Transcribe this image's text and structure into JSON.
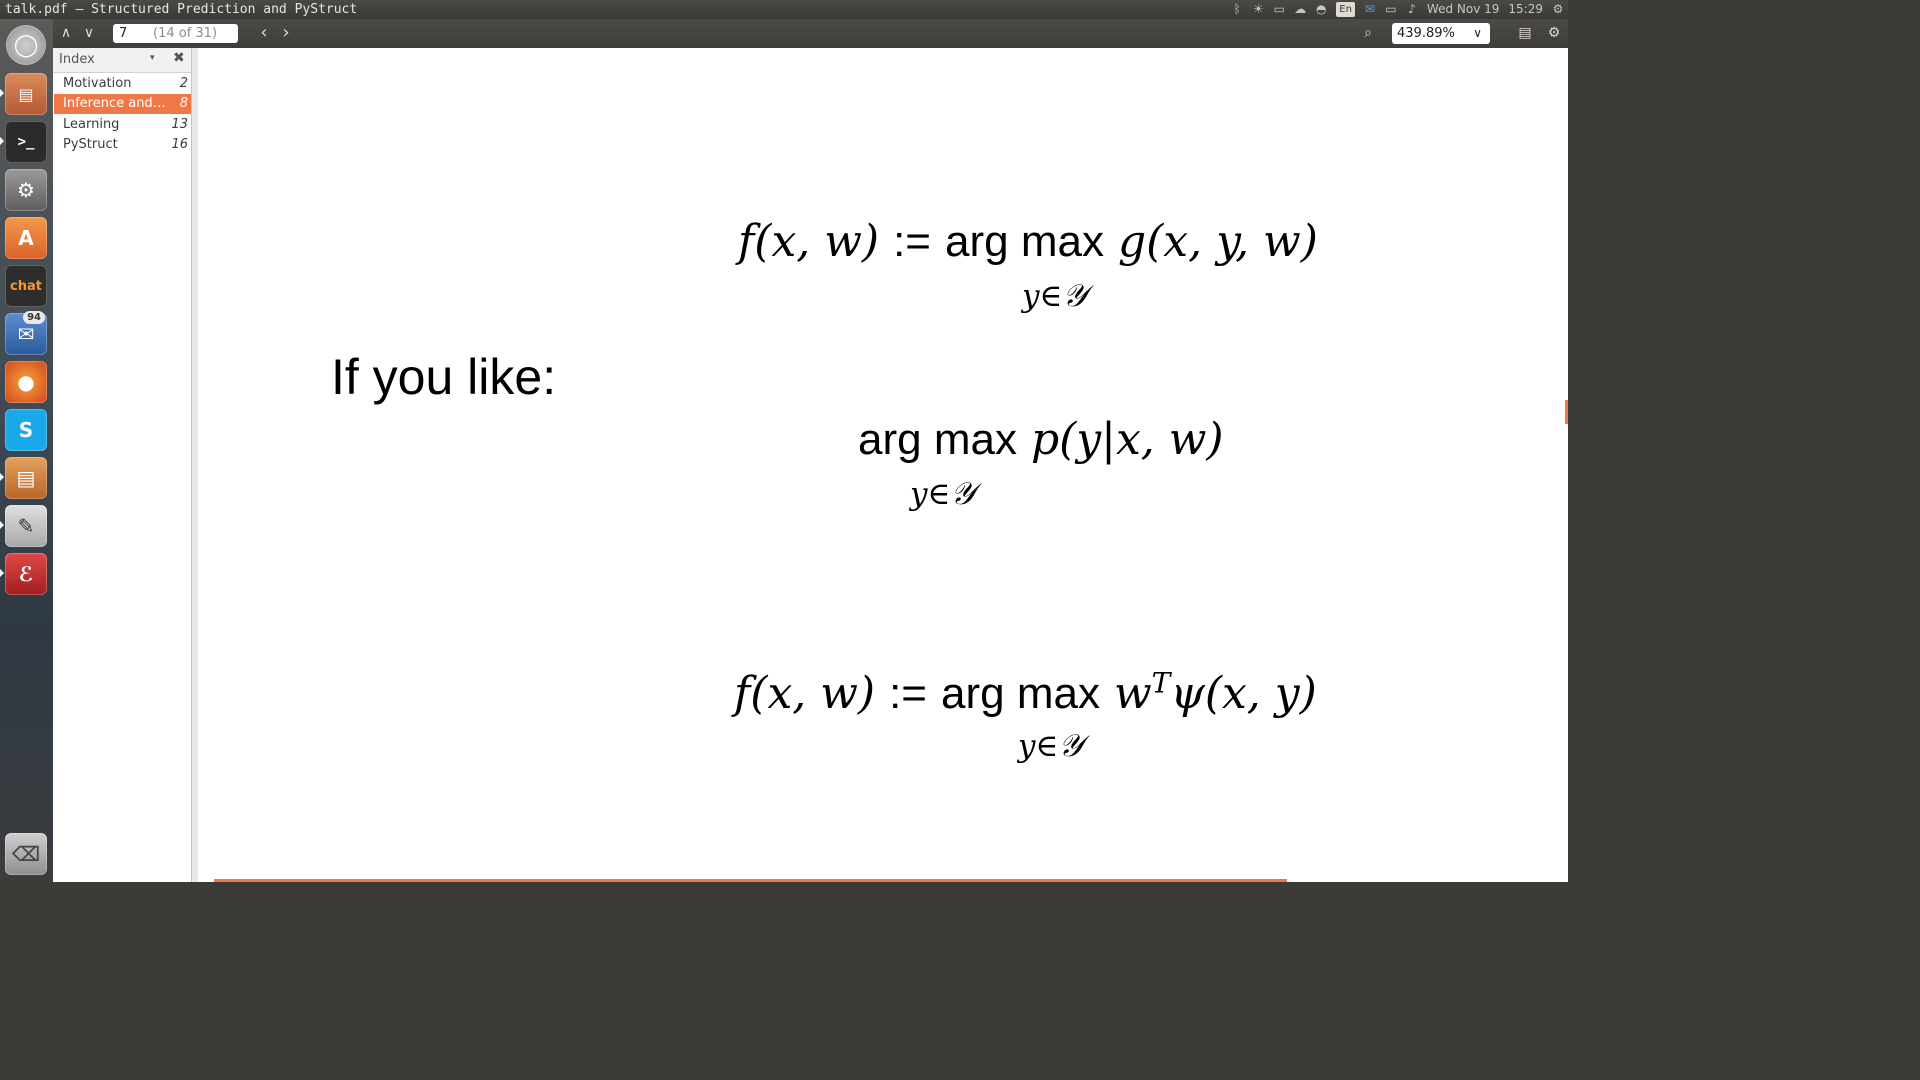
{
  "window": {
    "title": "talk.pdf — Structured Prediction and PyStruct"
  },
  "indicators": {
    "bluetooth": "ᛒ",
    "brightness": "☀",
    "display": "▭",
    "cloud": "☁",
    "wifi": "◓",
    "lang": "En",
    "mail": "✉",
    "battery": "▭",
    "volume": "♪",
    "date": "Wed Nov 19",
    "time": "15:29",
    "gear": "⚙"
  },
  "toolbar": {
    "prev_label": "∧",
    "next_label": "∨",
    "page_current": "7",
    "page_total": "(14 of 31)",
    "back_label": "‹",
    "forward_label": "›",
    "search_label": "⌕",
    "zoom": "439.89%",
    "zoom_chevron": "∨",
    "doc_label": "▤",
    "settings_label": "⚙"
  },
  "launcher": {
    "badge": "94",
    "icons": [
      "dash-home-icon",
      "files-icon",
      "terminal-icon",
      "system-settings-icon",
      "software-center-icon",
      "xchat-icon",
      "thunderbird-icon",
      "firefox-icon",
      "skype-icon",
      "impress-icon",
      "text-editor-icon",
      "document-viewer-icon",
      "trash-icon"
    ]
  },
  "sidebar": {
    "header": "Index",
    "dropdown": "▾",
    "close": "✖",
    "items": [
      {
        "label": "Motivation",
        "page": "2"
      },
      {
        "label": "Inference and…",
        "page": "8"
      },
      {
        "label": "Learning",
        "page": "13"
      },
      {
        "label": "PyStruct",
        "page": "16"
      }
    ]
  },
  "document": {
    "caption": "If you like:",
    "eq1": {
      "lhs": "f(x, w)",
      "assign": ":=",
      "op": "arg max",
      "rhs": "g(x, y, w)",
      "sub": "y∈𝒴"
    },
    "eq2": {
      "op": "arg max",
      "rhs": "p(y|x, w)",
      "sub": "y∈𝒴"
    },
    "eq3": {
      "lhs": "f(x, w)",
      "assign": ":=",
      "op": "arg max",
      "rhs_a": "w",
      "sup": "T",
      "rhs_b": "ψ(x, y)",
      "sub": "y∈𝒴"
    }
  },
  "colors": {
    "accent": "#f07746",
    "panel": "#3c3b37",
    "page": "#ffffff"
  }
}
